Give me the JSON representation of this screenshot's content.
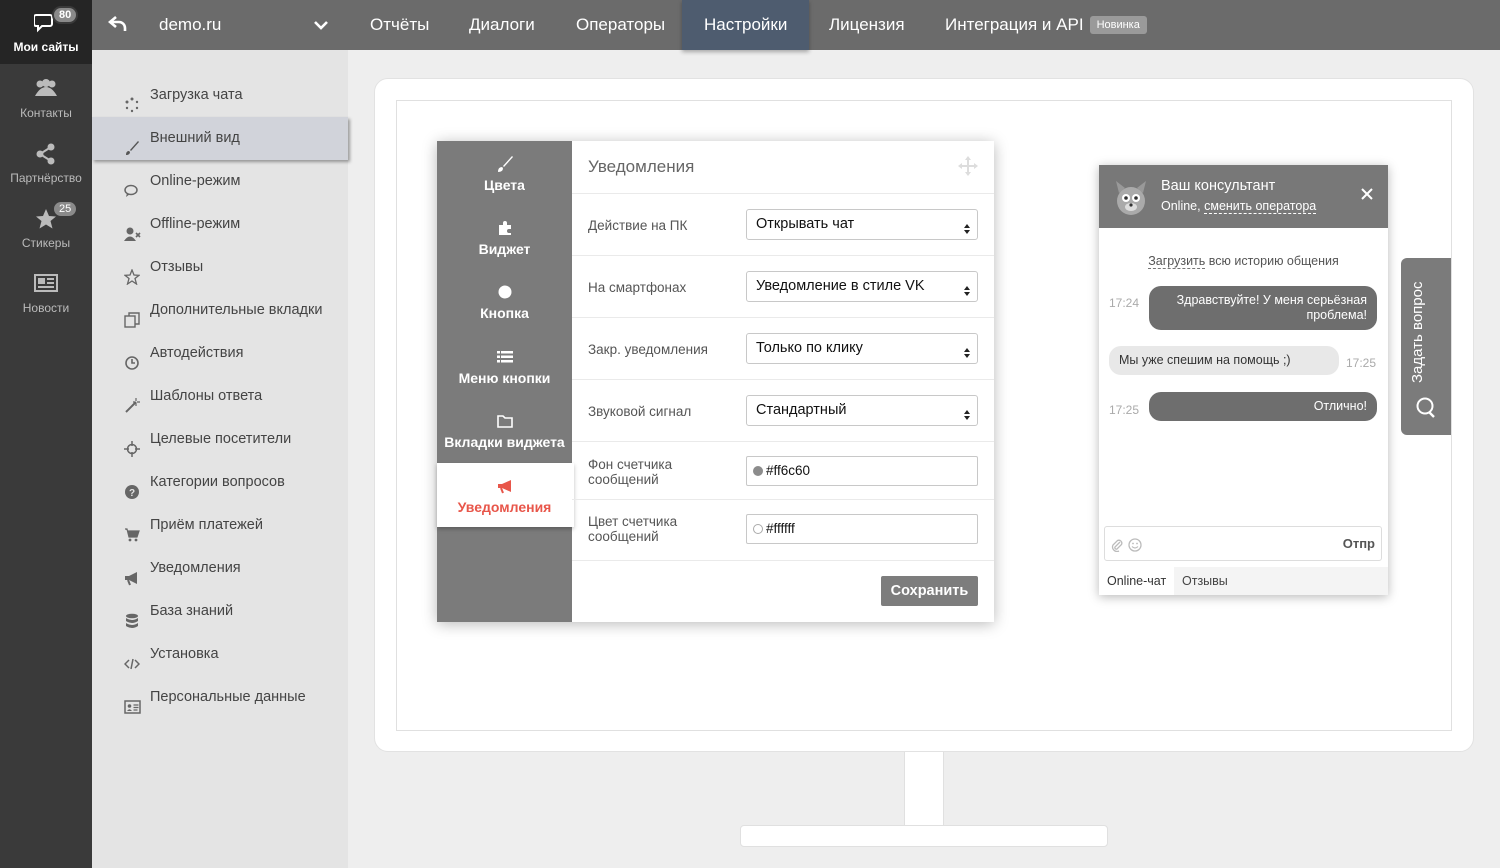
{
  "rail": {
    "items": [
      {
        "label": "Мои сайты",
        "badge": "80",
        "icon": "chat-bubbles-icon"
      },
      {
        "label": "Контакты",
        "icon": "contacts-icon"
      },
      {
        "label": "Партнёрство",
        "icon": "share-icon"
      },
      {
        "label": "Стикеры",
        "badge": "25",
        "icon": "star-icon"
      },
      {
        "label": "Новости",
        "icon": "newspaper-icon"
      }
    ]
  },
  "topbar": {
    "site": "demo.ru",
    "nav": [
      "Отчёты",
      "Диалоги",
      "Операторы",
      "Настройки",
      "Лицензия",
      "Интеграция и API"
    ],
    "active_nav": "Настройки",
    "new_badge": "Новинка"
  },
  "sidebar": {
    "active": "Внешний вид",
    "items": [
      {
        "label": "Загрузка чата",
        "icon": "loading-icon"
      },
      {
        "label": "Внешний вид",
        "icon": "brush-icon"
      },
      {
        "label": "Online-режим",
        "icon": "comments-icon"
      },
      {
        "label": "Offline-режим",
        "icon": "user-offline-icon"
      },
      {
        "label": "Отзывы",
        "icon": "star-outline-icon"
      },
      {
        "label": "Дополнительные вкладки",
        "icon": "tabs-icon"
      },
      {
        "label": "Автодействия",
        "icon": "clock-icon"
      },
      {
        "label": "Шаблоны ответа",
        "icon": "magic-wand-icon"
      },
      {
        "label": "Целевые посетители",
        "icon": "target-icon"
      },
      {
        "label": "Категории вопросов",
        "icon": "question-icon"
      },
      {
        "label": "Приём платежей",
        "icon": "cart-icon"
      },
      {
        "label": "Уведомления",
        "icon": "megaphone-icon"
      },
      {
        "label": "База знаний",
        "icon": "database-icon"
      },
      {
        "label": "Установка",
        "icon": "code-icon"
      },
      {
        "label": "Персональные данные",
        "icon": "id-card-icon"
      }
    ]
  },
  "dialog": {
    "title": "Уведомления",
    "tabs": [
      {
        "label": "Цвета",
        "icon": "brush-icon"
      },
      {
        "label": "Виджет",
        "icon": "puzzle-icon"
      },
      {
        "label": "Кнопка",
        "icon": "circle-icon"
      },
      {
        "label": "Меню кнопки",
        "icon": "list-icon"
      },
      {
        "label": "Вкладки виджета",
        "icon": "folder-icon"
      },
      {
        "label": "Уведомления",
        "icon": "megaphone-icon"
      }
    ],
    "active_tab": "Уведомления",
    "rows": [
      {
        "label": "Действие на ПК",
        "value": "Открывать чат"
      },
      {
        "label": "На смартфонах",
        "value": "Уведомление в стиле VK"
      },
      {
        "label": "Закр. уведомления",
        "value": "Только по клику"
      },
      {
        "label": "Звуковой сигнал",
        "value": "Стандартный"
      }
    ],
    "color_rows": [
      {
        "label": "Фон счетчика сообщений",
        "value": "#ff6c60",
        "swatch": "#8c8c8c"
      },
      {
        "label": "Цвет счетчика сообщений",
        "value": "#ffffff",
        "swatch": "#ffffff"
      }
    ],
    "save": "Сохранить"
  },
  "chat": {
    "name": "Ваш консультант",
    "status": "Online,",
    "change_link": "сменить оператора",
    "history_link": "Загрузить",
    "history_rest": " всю историю общения",
    "messages": [
      {
        "dir": "out",
        "time": "17:24",
        "text": "Здравствуйте! У меня серьёзная проблема!"
      },
      {
        "dir": "in",
        "time": "17:25",
        "text": "Мы уже спешим на помощь ;)"
      },
      {
        "dir": "out",
        "time": "17:25",
        "text": "Отлично!"
      }
    ],
    "send": "Отпр",
    "tabs": [
      "Online-чат",
      "Отзывы"
    ]
  },
  "ask_tab": {
    "label": "Задать вопрос"
  },
  "colors": {
    "accent": "#e8564a",
    "topbar": "#6b6b6b",
    "active_nav": "#4e5c6f",
    "rail": "#3a3a3a"
  }
}
